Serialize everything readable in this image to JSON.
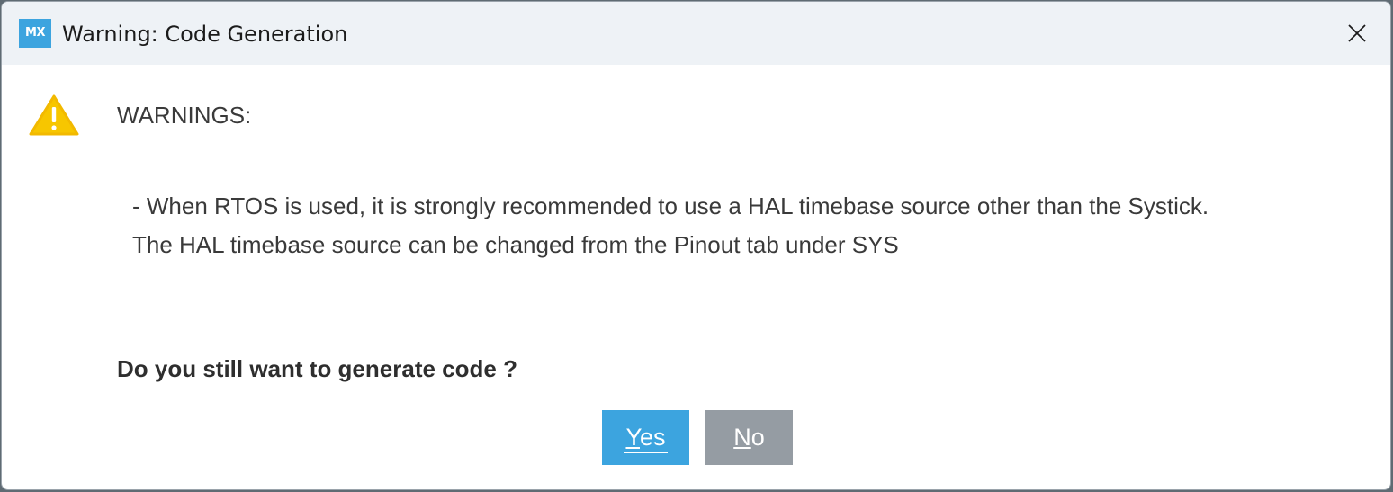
{
  "window": {
    "title": "Warning: Code Generation",
    "app_icon_text": "MX",
    "close_icon": "close-icon"
  },
  "content": {
    "warning_icon": "warning-triangle-icon",
    "heading": "WARNINGS:",
    "message_lines": [
      "- When RTOS is used, it is strongly recommended to use a HAL timebase source other than the Systick.",
      "The HAL timebase source can be changed from the Pinout tab under SYS"
    ],
    "question": "Do you still want to generate code ?"
  },
  "buttons": {
    "yes": {
      "mnemonic": "Y",
      "rest": "es"
    },
    "no": {
      "mnemonic": "N",
      "rest": "o"
    }
  },
  "colors": {
    "accent": "#3ca4df",
    "secondary_button": "#959ca3",
    "warning": "#f7c600",
    "titlebar": "#eef2f6"
  }
}
